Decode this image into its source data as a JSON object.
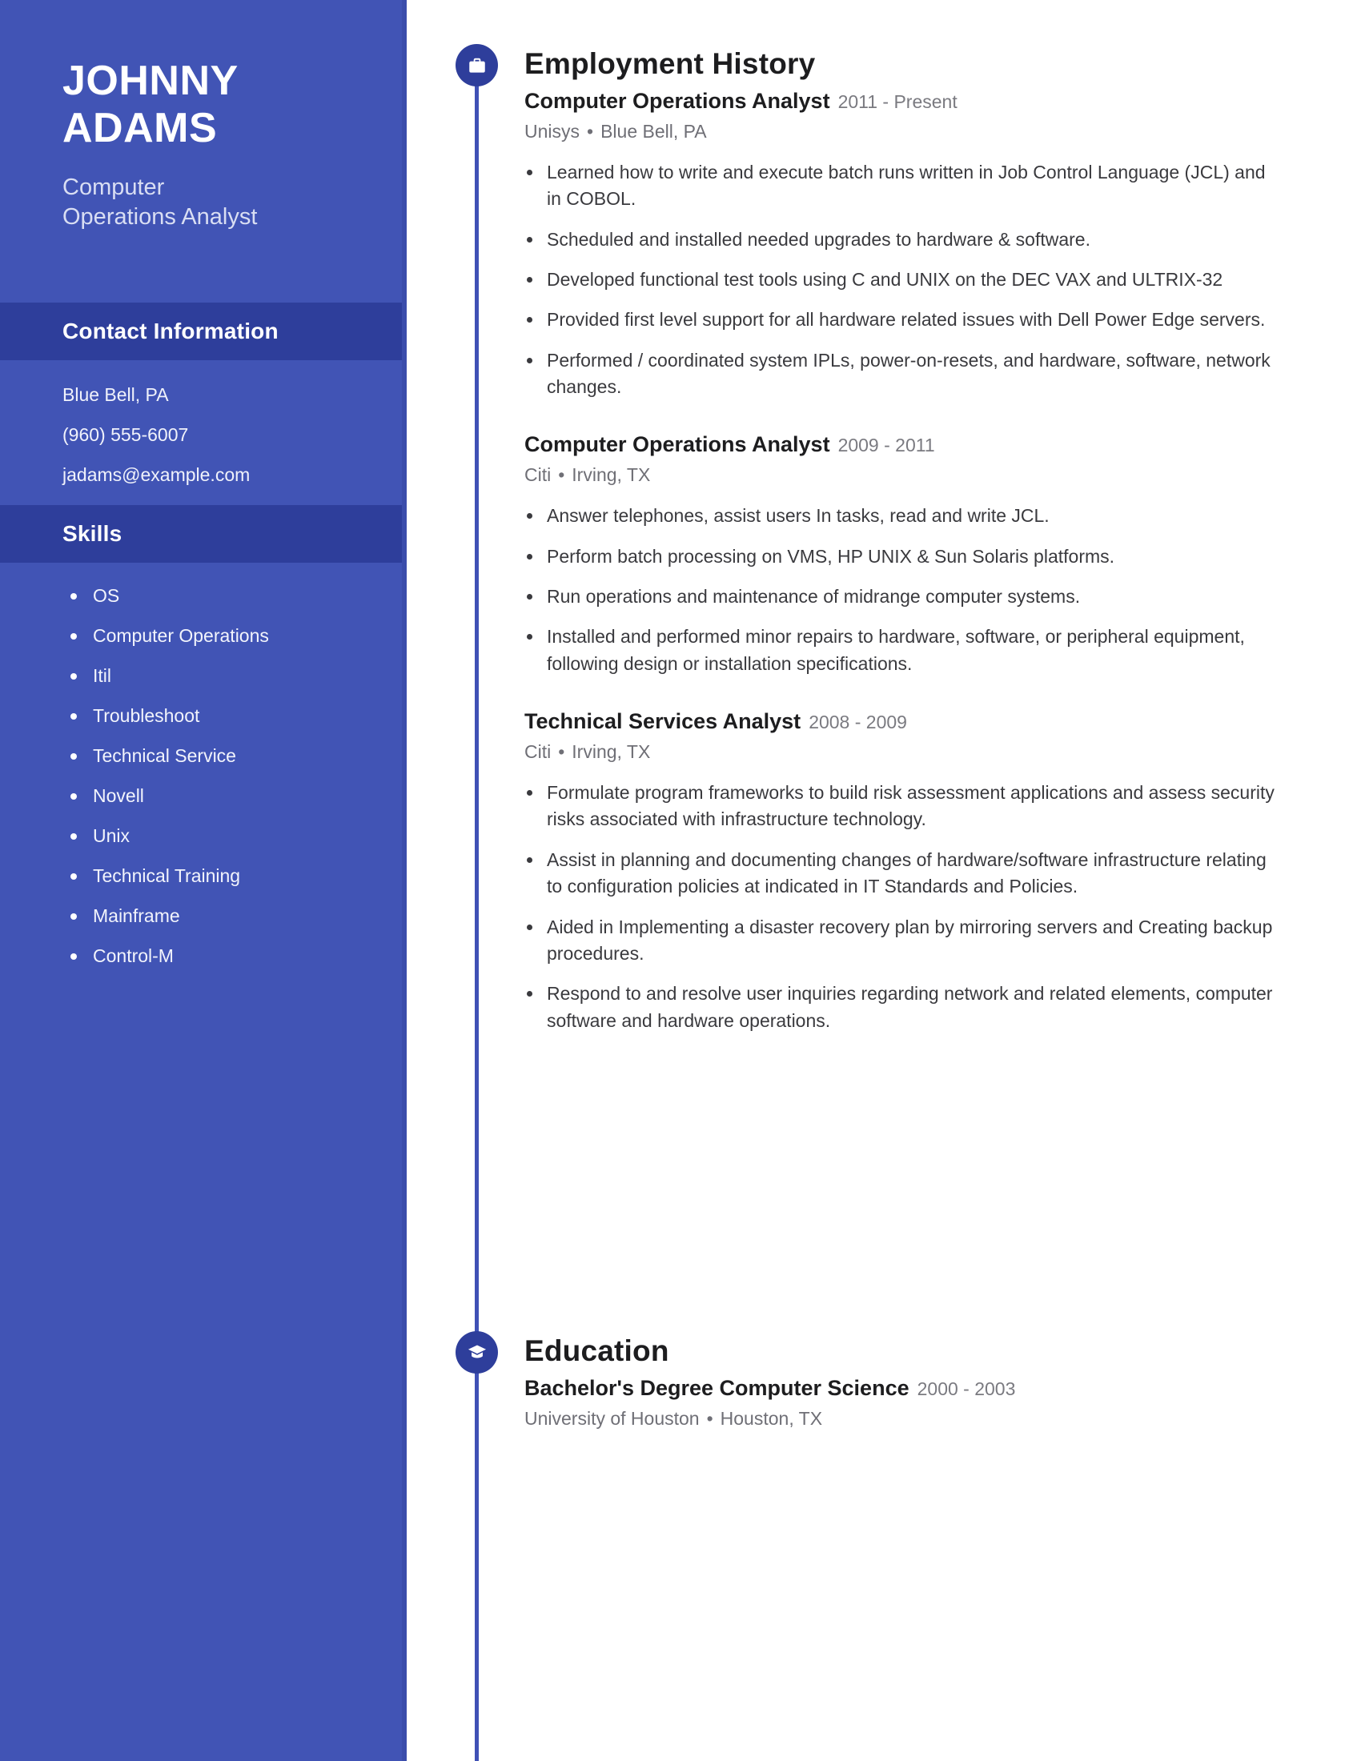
{
  "theme": {
    "sidebar_bg": "#4154B5",
    "band_bg": "#2E3E9B",
    "accent": "#3F51B5",
    "text_dark": "#1D1D1F",
    "text_muted": "#6F6F76"
  },
  "sidebar": {
    "name_line1": "JOHNNY",
    "name_line2": "ADAMS",
    "role_line1": "Computer",
    "role_line2": "Operations Analyst",
    "contact": {
      "heading": "Contact Information",
      "lines": [
        "Blue Bell, PA",
        "(960) 555-6007",
        "jadams@example.com"
      ]
    },
    "skills": {
      "heading": "Skills",
      "items": [
        "OS",
        "Computer Operations",
        "Itil",
        "Troubleshoot",
        "Technical Service",
        "Novell",
        "Unix",
        "Technical Training",
        "Mainframe",
        "Control-M"
      ]
    }
  },
  "employment": {
    "heading": "Employment History",
    "icon": "briefcase-icon",
    "jobs": [
      {
        "title": "Computer Operations Analyst",
        "dates": "2011 - Present",
        "company": "Unisys",
        "location": "Blue Bell, PA",
        "bullets": [
          "Learned how to write and execute batch runs written in Job Control Language (JCL) and in COBOL.",
          "Scheduled and installed needed upgrades to hardware & software.",
          "Developed functional test tools using C and UNIX on the DEC VAX and ULTRIX-32",
          "Provided first level support for all hardware related issues with Dell Power Edge servers.",
          "Performed / coordinated system IPLs, power-on-resets, and hardware, software, network changes."
        ]
      },
      {
        "title": "Computer Operations Analyst",
        "dates": "2009 - 2011",
        "company": "Citi",
        "location": "Irving, TX",
        "bullets": [
          "Answer telephones, assist users In tasks, read and write JCL.",
          "Perform batch processing on VMS, HP UNIX & Sun Solaris platforms.",
          "Run operations and maintenance of midrange computer systems.",
          "Installed and performed minor repairs to hardware, software, or peripheral equipment, following design or installation specifications."
        ]
      },
      {
        "title": "Technical Services Analyst",
        "dates": "2008 - 2009",
        "company": "Citi",
        "location": "Irving, TX",
        "bullets": [
          "Formulate program frameworks to build risk assessment applications and assess security risks associated with infrastructure technology.",
          "Assist in planning and documenting changes of hardware/software infrastructure relating to configuration policies at indicated in IT Standards and Policies.",
          "Aided in Implementing a disaster recovery plan by mirroring servers and Creating backup procedures.",
          "Respond to and resolve user inquiries regarding network and related elements, computer software and hardware operations."
        ]
      }
    ]
  },
  "education": {
    "heading": "Education",
    "icon": "graduation-cap-icon",
    "entries": [
      {
        "degree": "Bachelor's Degree Computer Science",
        "dates": "2000 - 2003",
        "school": "University of Houston",
        "location": "Houston, TX"
      }
    ]
  },
  "separator": "•"
}
